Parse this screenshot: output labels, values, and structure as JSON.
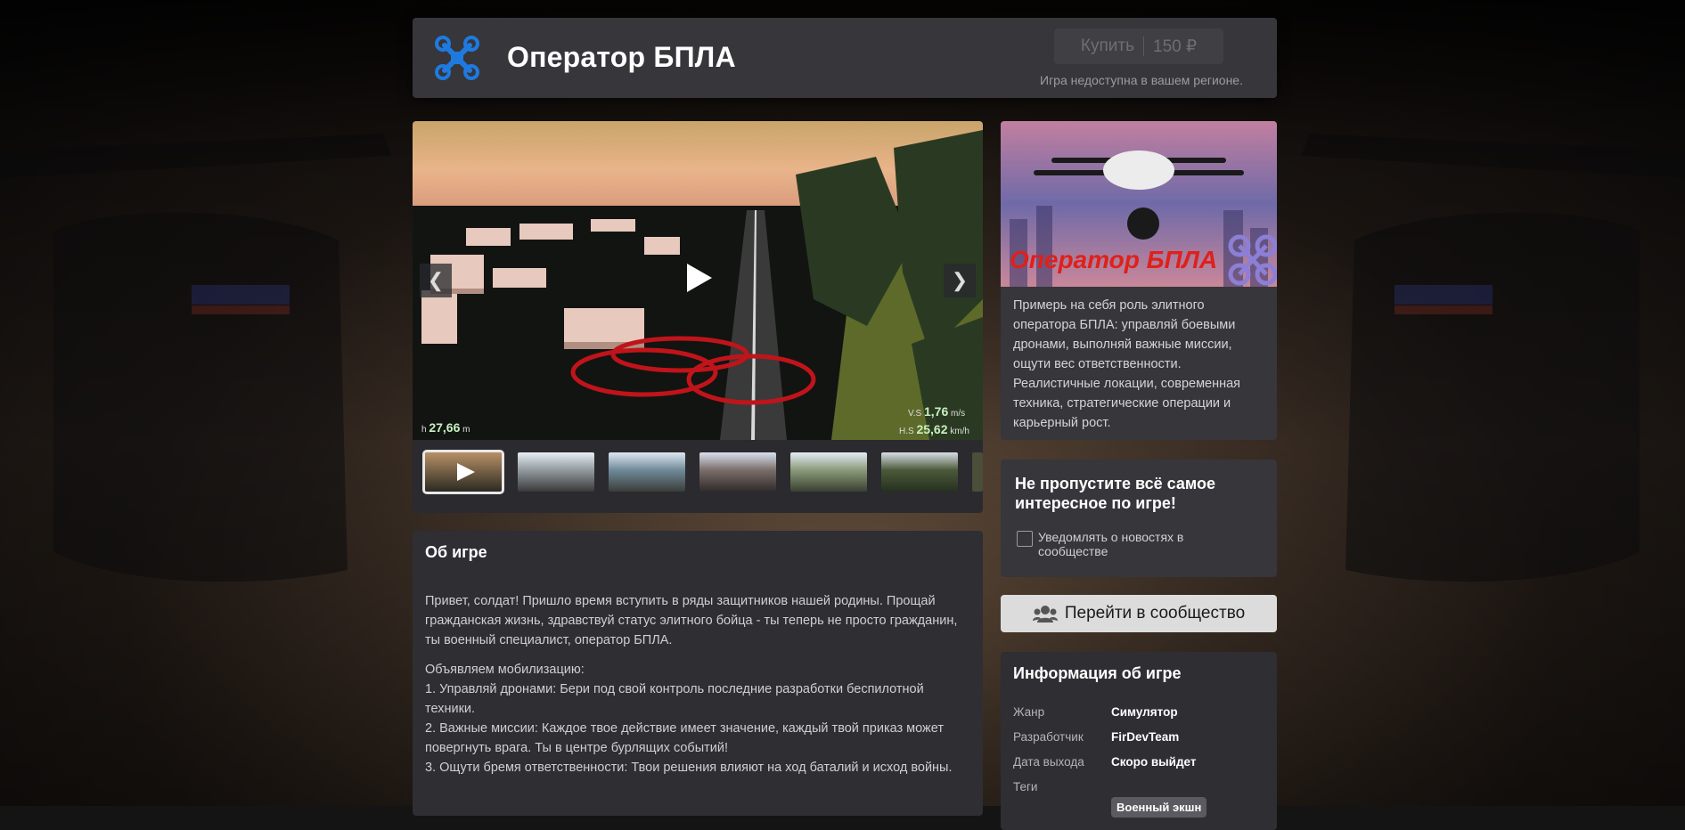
{
  "header": {
    "title": "Оператор БПЛА",
    "buy_label": "Купить",
    "price": "150 ₽",
    "region_note": "Игра недоступна в вашем регионе."
  },
  "media": {
    "hud": {
      "h_label": "h",
      "h_value": "27,66",
      "h_unit": "m",
      "vs_label": "V.S",
      "vs_value": "1,76",
      "vs_unit": "m/s",
      "hs_label": "H.S",
      "hs_value": "25,62",
      "hs_unit": "km/h"
    },
    "thumbnails": [
      "video",
      "screenshot",
      "screenshot",
      "screenshot",
      "screenshot",
      "screenshot"
    ]
  },
  "about": {
    "title": "Об игре",
    "paragraph1": "Привет, солдат! Пришло время вступить в ряды защитников нашей родины. Прощай гражданская жизнь, здравствуй статус элитного бойца - ты теперь не просто гражданин, ты военный специалист, оператор БПЛА.",
    "list_title": "Объявляем мобилизацию:",
    "item1": "1. Управляй дронами: Бери под свой контроль последние разработки беспилотной техники.",
    "item2": "2. Важные миссии: Каждое твое действие имеет значение, каждый твой приказ может повергнуть врага. Ты в центре бурлящих событий!",
    "item3": "3. Ощути бремя ответственности: Твои решения влияют на ход баталий и исход войны."
  },
  "cover": {
    "art_title": "Оператор БПЛА",
    "description": "Примерь на себя роль элитного оператора БПЛА: управляй боевыми дронами, выполняй важные миссии, ощути вес ответственности. Реалистичные локации, современная техника, стратегические операции и карьерный рост."
  },
  "notify": {
    "title": "Не пропустите всё самое интересное по игре!",
    "checkbox_label": "Уведомлять о новостях в сообществе"
  },
  "community_button": "Перейти в сообщество",
  "info": {
    "title": "Информация об игре",
    "genre_label": "Жанр",
    "genre": "Симулятор",
    "developer_label": "Разработчик",
    "developer": "FirDevTeam",
    "release_label": "Дата выхода",
    "release": "Скоро выйдет",
    "tags_label": "Теги",
    "tag1": "Военный экшн"
  },
  "colors": {
    "accent_blue": "#1f7ae0",
    "panel": "#36363b",
    "panel_dark": "#2e2e33"
  }
}
